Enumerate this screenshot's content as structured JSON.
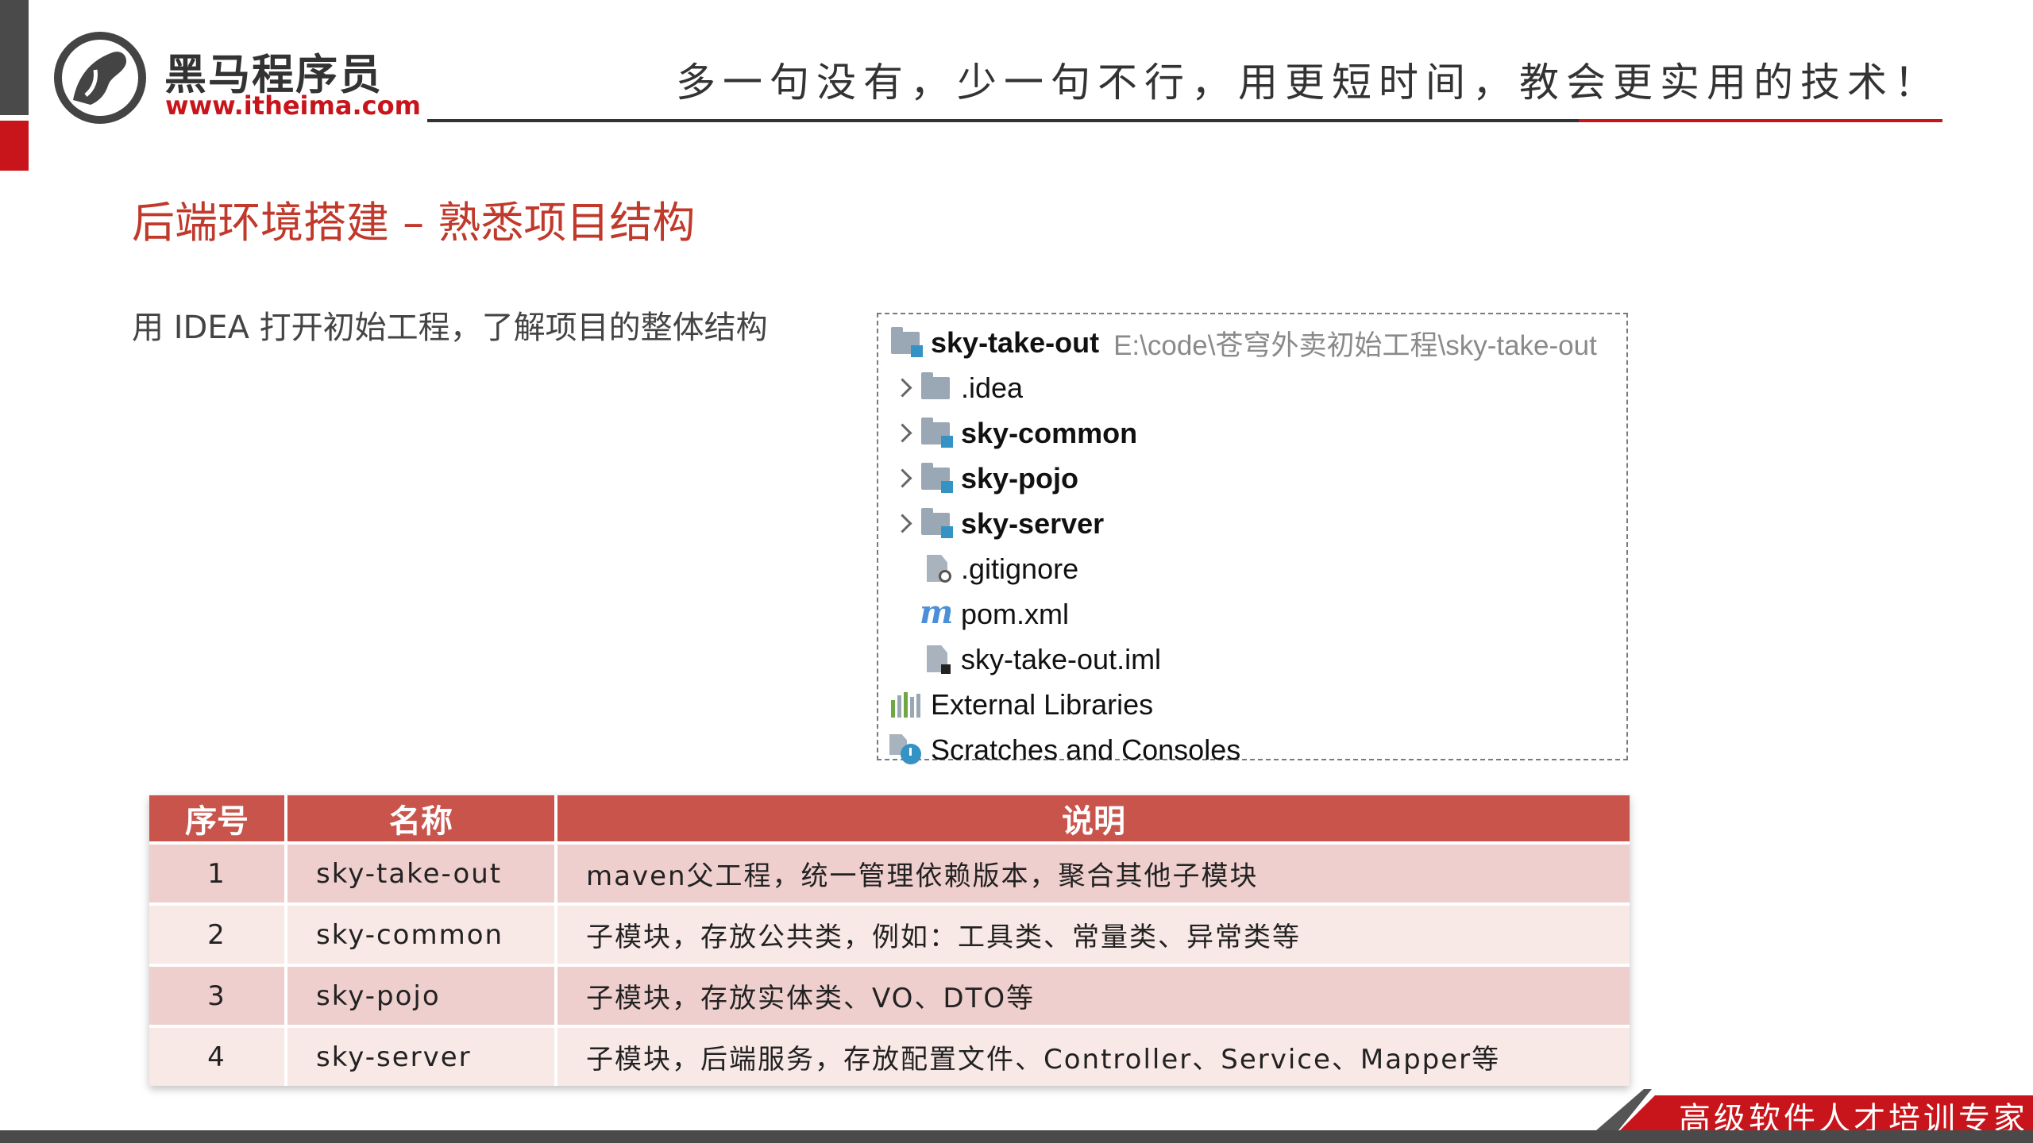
{
  "header": {
    "logo_name": "黑马程序员",
    "logo_url": "www.itheima.com",
    "slogan": "多一句没有，少一句不行，用更短时间，教会更实用的技术！"
  },
  "slide": {
    "title": "后端环境搭建 – 熟悉项目结构",
    "intro": "用 IDEA 打开初始工程，了解项目的整体结构"
  },
  "project_tree": {
    "root": {
      "label": "sky-take-out",
      "path": "E:\\code\\苍穹外卖初始工程\\sky-take-out",
      "icon": "module-folder-icon"
    },
    "items": [
      {
        "label": ".idea",
        "icon": "folder-icon"
      },
      {
        "label": "sky-common",
        "icon": "module-folder-icon"
      },
      {
        "label": "sky-pojo",
        "icon": "module-folder-icon"
      },
      {
        "label": "sky-server",
        "icon": "module-folder-icon"
      },
      {
        "label": ".gitignore",
        "icon": "gitignore-file-icon"
      },
      {
        "label": "pom.xml",
        "icon": "maven-icon"
      },
      {
        "label": "sky-take-out.iml",
        "icon": "iml-file-icon"
      },
      {
        "label": "External Libraries",
        "icon": "libraries-icon"
      },
      {
        "label": "Scratches and Consoles",
        "icon": "scratches-icon"
      }
    ]
  },
  "module_table": {
    "headers": [
      "序号",
      "名称",
      "说明"
    ],
    "rows": [
      {
        "index": "1",
        "name": "sky-take-out",
        "desc": "maven父工程，统一管理依赖版本，聚合其他子模块"
      },
      {
        "index": "2",
        "name": "sky-common",
        "desc": "子模块，存放公共类，例如：工具类、常量类、异常类等"
      },
      {
        "index": "3",
        "name": "sky-pojo",
        "desc": "子模块，存放实体类、VO、DTO等"
      },
      {
        "index": "4",
        "name": "sky-server",
        "desc": "子模块，后端服务，存放配置文件、Controller、Service、Mapper等"
      }
    ]
  },
  "footer": {
    "tagline": "高级软件人才培训专家"
  },
  "colors": {
    "brand_red": "#c8141b",
    "title_red": "#c0392b",
    "table_header": "#c9544c",
    "row_odd": "#eecfcd",
    "row_even": "#f8e8e6",
    "module_blue": "#3592c4"
  }
}
